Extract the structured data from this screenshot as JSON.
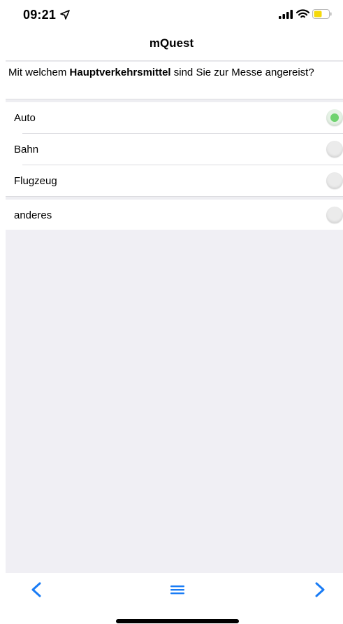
{
  "status_bar": {
    "time": "09:21"
  },
  "header": {
    "title": "mQuest"
  },
  "question": {
    "prefix": "Mit welchem ",
    "emphasis": "Hauptverkehrsmittel",
    "suffix": " sind Sie zur Messe angereist?"
  },
  "options": [
    {
      "label": "Auto",
      "selected": true
    },
    {
      "label": "Bahn",
      "selected": false
    },
    {
      "label": "Flugzeug",
      "selected": false
    },
    {
      "label": "anderes",
      "selected": false
    }
  ],
  "colors": {
    "accent": "#1a7cf5",
    "selected_radio": "#6fd36f",
    "battery": "#f5d90a"
  },
  "icons": {
    "back": "chevron-left-icon",
    "menu": "menu-icon",
    "forward": "chevron-right-icon"
  }
}
